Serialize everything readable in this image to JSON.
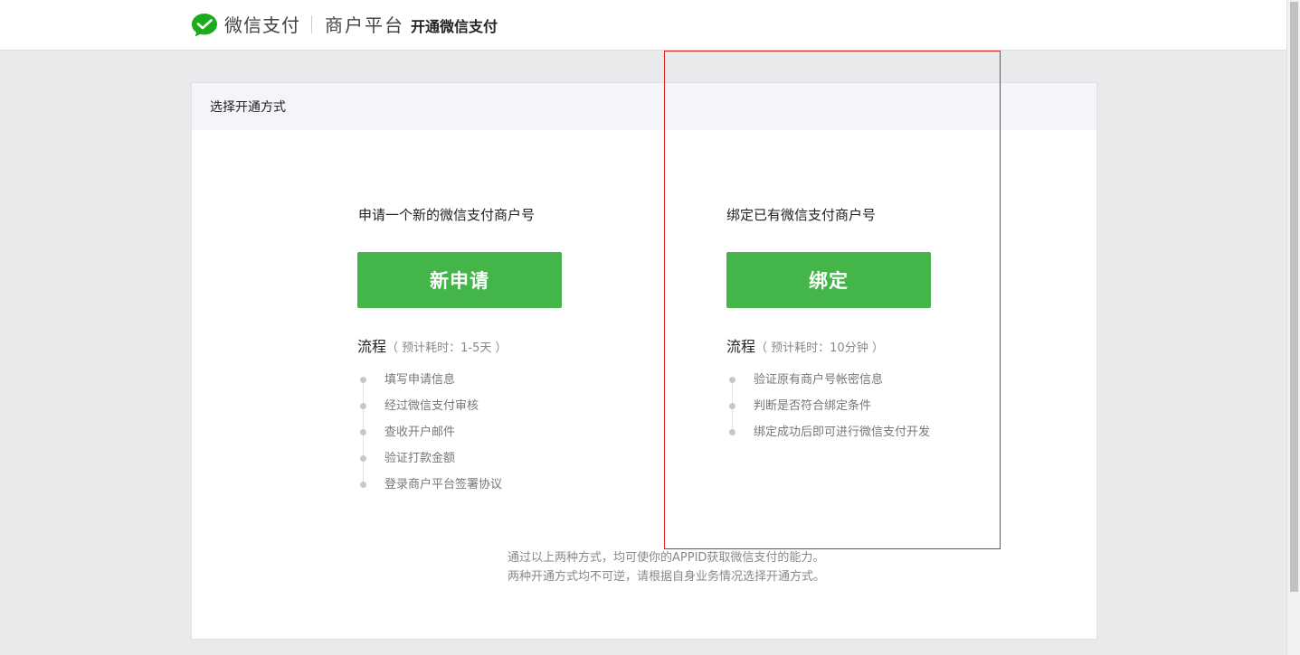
{
  "header": {
    "brand": "微信支付",
    "platform": "商户平台",
    "subtitle": "开通微信支付",
    "logo_icon": "wechat-pay-logo-icon",
    "brand_color": "#1aad19"
  },
  "panel": {
    "title": "选择开通方式"
  },
  "options": [
    {
      "title": "申请一个新的微信支付商户号",
      "button_label": "新申请",
      "flow_label": "流程",
      "flow_meta": "（ 预计耗时：1-5天 ）",
      "steps": [
        "填写申请信息",
        "经过微信支付审核",
        "查收开户邮件",
        "验证打款金额",
        "登录商户平台签署协议"
      ]
    },
    {
      "title": "绑定已有微信支付商户号",
      "button_label": "绑定",
      "flow_label": "流程",
      "flow_meta": "（ 预计耗时：10分钟 ）",
      "steps": [
        "验证原有商户号帐密信息",
        "判断是否符合绑定条件",
        "绑定成功后即可进行微信支付开发"
      ]
    }
  ],
  "notes": {
    "line1": "通过以上两种方式，均可使你的APPID获取微信支付的能力。",
    "line2": "两种开通方式均不可逆，请根据自身业务情况选择开通方式。"
  },
  "colors": {
    "button": "#44b549",
    "highlight": "#e02020"
  }
}
